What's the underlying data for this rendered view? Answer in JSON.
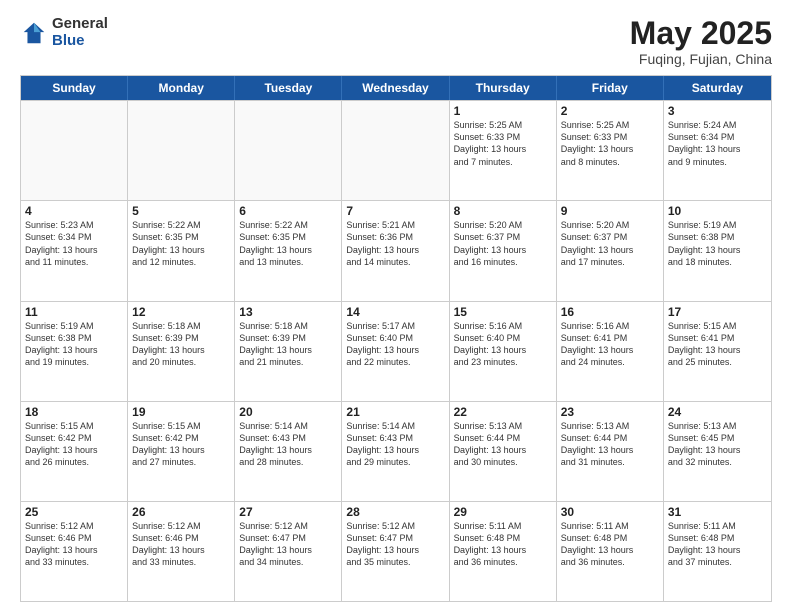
{
  "logo": {
    "general": "General",
    "blue": "Blue"
  },
  "title": {
    "month": "May 2025",
    "location": "Fuqing, Fujian, China"
  },
  "days_header": [
    "Sunday",
    "Monday",
    "Tuesday",
    "Wednesday",
    "Thursday",
    "Friday",
    "Saturday"
  ],
  "weeks": [
    [
      {
        "day": "",
        "info": ""
      },
      {
        "day": "",
        "info": ""
      },
      {
        "day": "",
        "info": ""
      },
      {
        "day": "",
        "info": ""
      },
      {
        "day": "1",
        "info": "Sunrise: 5:25 AM\nSunset: 6:33 PM\nDaylight: 13 hours\nand 7 minutes."
      },
      {
        "day": "2",
        "info": "Sunrise: 5:25 AM\nSunset: 6:33 PM\nDaylight: 13 hours\nand 8 minutes."
      },
      {
        "day": "3",
        "info": "Sunrise: 5:24 AM\nSunset: 6:34 PM\nDaylight: 13 hours\nand 9 minutes."
      }
    ],
    [
      {
        "day": "4",
        "info": "Sunrise: 5:23 AM\nSunset: 6:34 PM\nDaylight: 13 hours\nand 11 minutes."
      },
      {
        "day": "5",
        "info": "Sunrise: 5:22 AM\nSunset: 6:35 PM\nDaylight: 13 hours\nand 12 minutes."
      },
      {
        "day": "6",
        "info": "Sunrise: 5:22 AM\nSunset: 6:35 PM\nDaylight: 13 hours\nand 13 minutes."
      },
      {
        "day": "7",
        "info": "Sunrise: 5:21 AM\nSunset: 6:36 PM\nDaylight: 13 hours\nand 14 minutes."
      },
      {
        "day": "8",
        "info": "Sunrise: 5:20 AM\nSunset: 6:37 PM\nDaylight: 13 hours\nand 16 minutes."
      },
      {
        "day": "9",
        "info": "Sunrise: 5:20 AM\nSunset: 6:37 PM\nDaylight: 13 hours\nand 17 minutes."
      },
      {
        "day": "10",
        "info": "Sunrise: 5:19 AM\nSunset: 6:38 PM\nDaylight: 13 hours\nand 18 minutes."
      }
    ],
    [
      {
        "day": "11",
        "info": "Sunrise: 5:19 AM\nSunset: 6:38 PM\nDaylight: 13 hours\nand 19 minutes."
      },
      {
        "day": "12",
        "info": "Sunrise: 5:18 AM\nSunset: 6:39 PM\nDaylight: 13 hours\nand 20 minutes."
      },
      {
        "day": "13",
        "info": "Sunrise: 5:18 AM\nSunset: 6:39 PM\nDaylight: 13 hours\nand 21 minutes."
      },
      {
        "day": "14",
        "info": "Sunrise: 5:17 AM\nSunset: 6:40 PM\nDaylight: 13 hours\nand 22 minutes."
      },
      {
        "day": "15",
        "info": "Sunrise: 5:16 AM\nSunset: 6:40 PM\nDaylight: 13 hours\nand 23 minutes."
      },
      {
        "day": "16",
        "info": "Sunrise: 5:16 AM\nSunset: 6:41 PM\nDaylight: 13 hours\nand 24 minutes."
      },
      {
        "day": "17",
        "info": "Sunrise: 5:15 AM\nSunset: 6:41 PM\nDaylight: 13 hours\nand 25 minutes."
      }
    ],
    [
      {
        "day": "18",
        "info": "Sunrise: 5:15 AM\nSunset: 6:42 PM\nDaylight: 13 hours\nand 26 minutes."
      },
      {
        "day": "19",
        "info": "Sunrise: 5:15 AM\nSunset: 6:42 PM\nDaylight: 13 hours\nand 27 minutes."
      },
      {
        "day": "20",
        "info": "Sunrise: 5:14 AM\nSunset: 6:43 PM\nDaylight: 13 hours\nand 28 minutes."
      },
      {
        "day": "21",
        "info": "Sunrise: 5:14 AM\nSunset: 6:43 PM\nDaylight: 13 hours\nand 29 minutes."
      },
      {
        "day": "22",
        "info": "Sunrise: 5:13 AM\nSunset: 6:44 PM\nDaylight: 13 hours\nand 30 minutes."
      },
      {
        "day": "23",
        "info": "Sunrise: 5:13 AM\nSunset: 6:44 PM\nDaylight: 13 hours\nand 31 minutes."
      },
      {
        "day": "24",
        "info": "Sunrise: 5:13 AM\nSunset: 6:45 PM\nDaylight: 13 hours\nand 32 minutes."
      }
    ],
    [
      {
        "day": "25",
        "info": "Sunrise: 5:12 AM\nSunset: 6:46 PM\nDaylight: 13 hours\nand 33 minutes."
      },
      {
        "day": "26",
        "info": "Sunrise: 5:12 AM\nSunset: 6:46 PM\nDaylight: 13 hours\nand 33 minutes."
      },
      {
        "day": "27",
        "info": "Sunrise: 5:12 AM\nSunset: 6:47 PM\nDaylight: 13 hours\nand 34 minutes."
      },
      {
        "day": "28",
        "info": "Sunrise: 5:12 AM\nSunset: 6:47 PM\nDaylight: 13 hours\nand 35 minutes."
      },
      {
        "day": "29",
        "info": "Sunrise: 5:11 AM\nSunset: 6:48 PM\nDaylight: 13 hours\nand 36 minutes."
      },
      {
        "day": "30",
        "info": "Sunrise: 5:11 AM\nSunset: 6:48 PM\nDaylight: 13 hours\nand 36 minutes."
      },
      {
        "day": "31",
        "info": "Sunrise: 5:11 AM\nSunset: 6:48 PM\nDaylight: 13 hours\nand 37 minutes."
      }
    ]
  ]
}
